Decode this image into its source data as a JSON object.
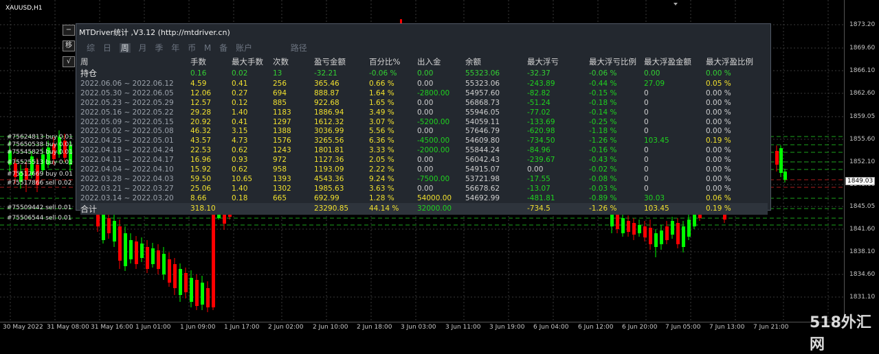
{
  "symbol": "XAUUSD,H1",
  "y_axis": [
    "1873.20",
    "1869.60",
    "1866.10",
    "1862.60",
    "1859.05",
    "1855.60",
    "1852.10",
    "1848.60",
    "1845.05",
    "1841.60",
    "1838.10",
    "1834.60",
    "1831.10"
  ],
  "current_price": "1849.03",
  "x_axis": [
    "30 May 2022",
    "31 May 08:00",
    "31 May 16:00",
    "1 Jun 01:00",
    "1 Jun 09:00",
    "1 Jun 17:00",
    "2 Jun 02:00",
    "2 Jun 10:00",
    "2 Jun 18:00",
    "3 Jun 03:00",
    "3 Jun 11:00",
    "3 Jun 19:00",
    "6 Jun 04:00",
    "6 Jun 12:00",
    "6 Jun 20:00",
    "7 Jun 05:00",
    "7 Jun 13:00",
    "7 Jun 21:00"
  ],
  "orders": [
    "#75624813 buy 0.01",
    "#75650538 buy 0.01",
    "#75545825 buy 0.01",
    "#75525513 buy 0.01",
    "#75512669 buy 0.01",
    "#75517866 sell 0.02",
    "#75509442 sell 0.01",
    "#75506544 sell 0.01"
  ],
  "side_buttons": [
    "−",
    "移",
    "√"
  ],
  "panel": {
    "title": "MTDriver统计 ,V3.12 (http://mtdriver.cn)",
    "tabs": [
      "综",
      "日",
      "周",
      "月",
      "季",
      "年",
      "币",
      "M",
      "备",
      "账户",
      "路径"
    ],
    "active_tab": "周",
    "headers": [
      "周",
      "手数",
      "最大手数",
      "次数",
      "盈亏金额",
      "百分比%",
      "出入金",
      "余额",
      "最大浮亏",
      "最大浮亏比例",
      "最大浮盈金额",
      "最大浮盈比例"
    ],
    "holding": [
      "持仓",
      "0.16",
      "0.02",
      "13",
      "-32.21",
      "-0.06 %",
      "0.00",
      "55323.06",
      "-32.37",
      "-0.06 %",
      "0.00",
      "0.00 %"
    ],
    "weeks": [
      [
        "2022.06.06 ~ 2022.06.12",
        "4.59",
        "0.41",
        "256",
        "365.46",
        "0.66 %",
        "0.00",
        "55323.06",
        "-243.89",
        "-0.44 %",
        "27.09",
        "0.05 %"
      ],
      [
        "2022.05.30 ~ 2022.06.05",
        "12.06",
        "0.27",
        "694",
        "888.87",
        "1.64 %",
        "-2800.00",
        "54957.60",
        "-82.82",
        "-0.15 %",
        "0",
        "0.00 %"
      ],
      [
        "2022.05.23 ~ 2022.05.29",
        "12.57",
        "0.12",
        "885",
        "922.68",
        "1.65 %",
        "0.00",
        "56868.73",
        "-51.24",
        "-0.18 %",
        "0",
        "0.00 %"
      ],
      [
        "2022.05.16 ~ 2022.05.22",
        "29.28",
        "1.40",
        "1183",
        "1886.94",
        "3.49 %",
        "0.00",
        "55946.05",
        "-77.02",
        "-0.14 %",
        "0",
        "0.00 %"
      ],
      [
        "2022.05.09 ~ 2022.05.15",
        "20.92",
        "0.41",
        "1297",
        "1612.32",
        "3.07 %",
        "-5200.00",
        "54059.11",
        "-133.69",
        "-0.25 %",
        "0",
        "0.00 %"
      ],
      [
        "2022.05.02 ~ 2022.05.08",
        "46.32",
        "3.15",
        "1388",
        "3036.99",
        "5.56 %",
        "0.00",
        "57646.79",
        "-620.98",
        "-1.18 %",
        "0",
        "0.00 %"
      ],
      [
        "2022.04.25 ~ 2022.05.01",
        "43.57",
        "4.73",
        "1576",
        "3265.56",
        "6.36 %",
        "-4500.00",
        "54609.80",
        "-734.50",
        "-1.26 %",
        "103.45",
        "0.19 %"
      ],
      [
        "2022.04.18 ~ 2022.04.24",
        "22.53",
        "0.62",
        "1243",
        "1801.81",
        "3.33 %",
        "-2000.00",
        "55844.24",
        "-84.96",
        "-0.16 %",
        "0",
        "0.00 %"
      ],
      [
        "2022.04.11 ~ 2022.04.17",
        "16.96",
        "0.93",
        "972",
        "1127.36",
        "2.05 %",
        "0.00",
        "56042.43",
        "-239.67",
        "-0.43 %",
        "0",
        "0.00 %"
      ],
      [
        "2022.04.04 ~ 2022.04.10",
        "15.92",
        "0.62",
        "958",
        "1193.09",
        "2.22 %",
        "0.00",
        "54915.07",
        "0.00",
        "-0.02 %",
        "0",
        "0.00 %"
      ],
      [
        "2022.03.28 ~ 2022.04.03",
        "59.50",
        "10.65",
        "1393",
        "4543.36",
        "9.24 %",
        "-7500.00",
        "53721.98",
        "-17.55",
        "-0.08 %",
        "0",
        "0.00 %"
      ],
      [
        "2022.03.21 ~ 2022.03.27",
        "25.06",
        "1.40",
        "1302",
        "1985.63",
        "3.63 %",
        "0.00",
        "56678.62",
        "-13.07",
        "-0.03 %",
        "0",
        "0.00 %"
      ],
      [
        "2022.03.14 ~ 2022.03.20",
        "8.66",
        "0.18",
        "665",
        "692.99",
        "1.28 %",
        "54000.00",
        "54692.99",
        "-481.81",
        "-0.89 %",
        "30.03",
        "0.06 %"
      ]
    ],
    "total": [
      "合计",
      "318.10",
      "",
      "",
      "23290.85",
      "44.14 %",
      "32000.00",
      "",
      "-734.5",
      "-1.26 %",
      "103.45",
      "0.19 %"
    ]
  },
  "watermark": "518外汇网",
  "colors": {
    "bull": "#00ff00",
    "bear": "#ff0000",
    "panel_bg": "#23282f",
    "value_yellow": "#f0e02e",
    "value_green": "#1fd21f"
  }
}
